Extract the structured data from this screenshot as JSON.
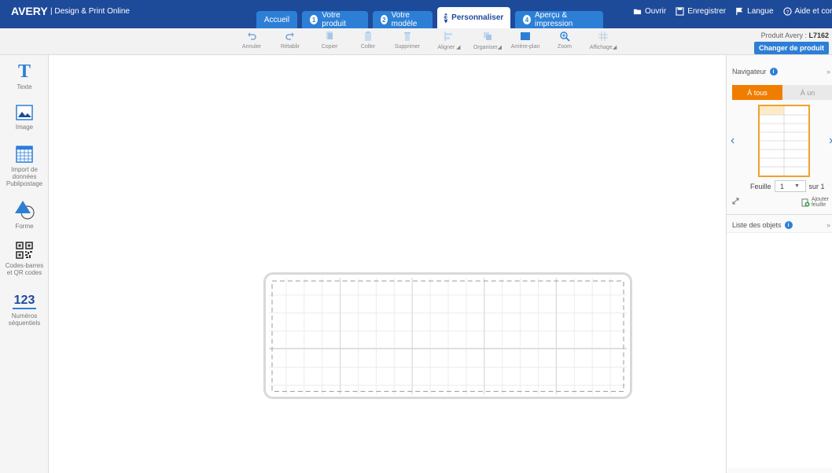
{
  "brand": {
    "logo": "AVERY",
    "subtitle": "Design & Print Online"
  },
  "tabs": [
    {
      "num": "",
      "label": "Accueil"
    },
    {
      "num": "1",
      "label": "Votre produit"
    },
    {
      "num": "2",
      "label": "Votre modèle"
    },
    {
      "num": "3",
      "label": "Personnaliser"
    },
    {
      "num": "4",
      "label": "Aperçu & impression"
    }
  ],
  "top_actions": {
    "open": "Ouvrir",
    "save": "Enregistrer",
    "language": "Langue",
    "help": "Aide et confidentialit"
  },
  "toolbar": {
    "undo": "Annuler",
    "redo": "Rétablir",
    "copy": "Copier",
    "paste": "Coller",
    "delete": "Supprimer",
    "align": "Aligner",
    "arrange": "Organiser",
    "background": "Arrière-plan",
    "zoom": "Zoom",
    "display": "Affichage"
  },
  "product": {
    "label": "Produit Avery :",
    "code": "L7162",
    "change_button": "Changer de produit"
  },
  "sidebar": {
    "text": "Texte",
    "image": "Image",
    "import_1": "Import de",
    "import_2": "données",
    "import_3": "Publipostage",
    "shape": "Forme",
    "barcode_1": "Codes-barres",
    "barcode_2": "et QR codes",
    "seq_icon": "123",
    "seq_1": "Numéros",
    "seq_2": "séquentiels"
  },
  "navigator": {
    "title": "Navigateur",
    "tab_all": "À tous",
    "tab_one": "À un",
    "sheet_label": "Feuille",
    "sheet_value": "1",
    "sheet_total": "sur 1",
    "add_1": "Ajouter",
    "add_2": "feuille",
    "close": "»"
  },
  "objects": {
    "title": "Liste des objets",
    "close": "»"
  },
  "colors": {
    "header": "#1e4a9a",
    "tab": "#2d7fd6",
    "accent": "#f07d00"
  }
}
